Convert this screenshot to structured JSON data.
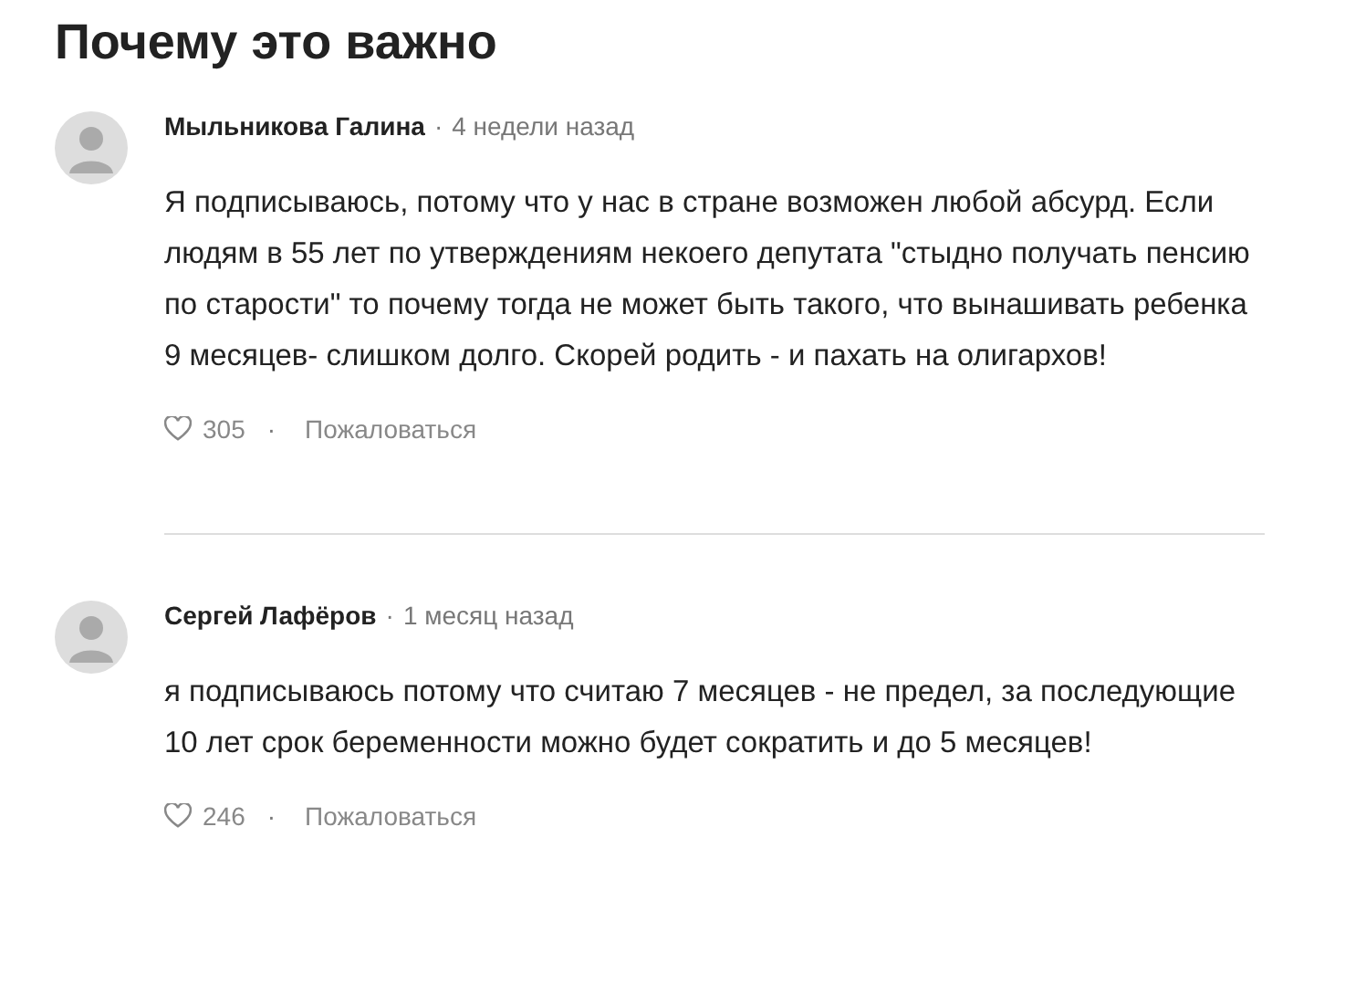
{
  "title": "Почему это важно",
  "comments": [
    {
      "author": "Мыльникова Галина",
      "separator": "·",
      "time": "4 недели назад",
      "text": "Я подписываюсь, потому что у нас в стране возможен любой абсурд. Если людям в 55 лет по утверждениям некоего депутата \"стыдно получать пенсию по старости\" то почему тогда не может быть такого, что вынашивать ребенка 9 месяцев- слишком долго. Скорей родить - и пахать на олигархов!",
      "likes": "305",
      "action_separator": "·",
      "report": "Пожаловаться"
    },
    {
      "author": "Сергей Лафёров",
      "separator": "·",
      "time": "1 месяц назад",
      "text": "я подписываюсь потому что считаю 7 месяцев - не предел, за последующие 10 лет срок беременности можно будет сократить и до 5 месяцев!",
      "likes": "246",
      "action_separator": "·",
      "report": "Пожаловаться"
    }
  ]
}
